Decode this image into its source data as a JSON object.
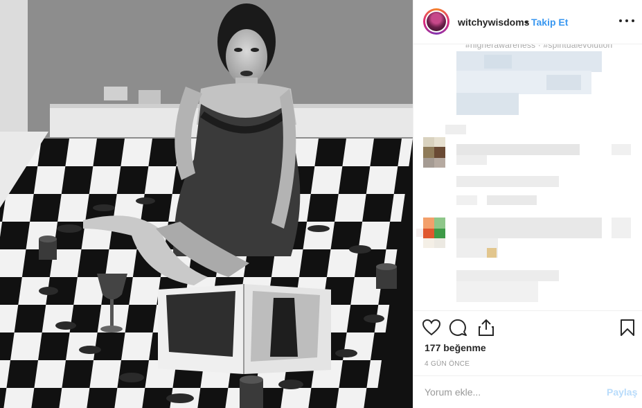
{
  "post": {
    "username": "witchywisdoms",
    "separator": "•",
    "follow_label": "Takip Et",
    "likes_label": "177 beğenme",
    "time_label": "4 GÜN ÖNCE",
    "comment_placeholder": "Yorum ekle...",
    "share_label": "Paylaş",
    "caption_cut_text": "#higherawareness · #spiritualevolution"
  },
  "icons": {
    "more": "more-options-icon",
    "like": "heart-icon",
    "comment": "speech-bubble-icon",
    "share": "share-upload-icon",
    "save": "bookmark-icon"
  },
  "colors": {
    "follow": "#3897f0",
    "share_disabled": "#b9dcfb",
    "text": "#262626",
    "muted": "#999999",
    "divider": "#efefef"
  }
}
